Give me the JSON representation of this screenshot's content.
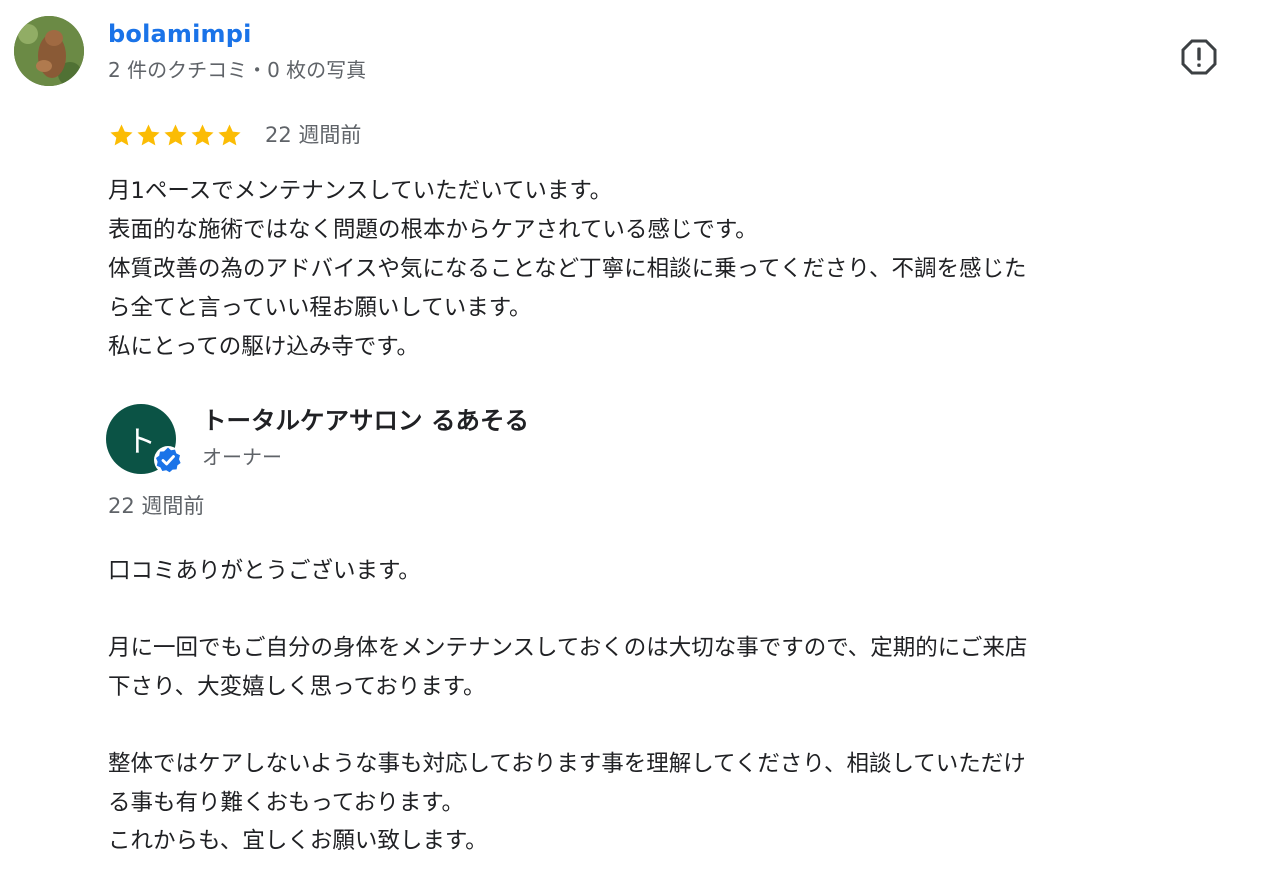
{
  "reviewer": {
    "name": "bolamimpi",
    "meta": "2 件のクチコミ・0 枚の写真",
    "avatar_icon": "user-photo-avatar"
  },
  "actions": {
    "report_icon": "report-flag-icon"
  },
  "review": {
    "rating": 5,
    "rating_max": 5,
    "star_color": "#fbbc04",
    "date": "22 週間前",
    "text": "月1ペースでメンテナンスしていただいています。\n表面的な施術ではなく問題の根本からケアされている感じです。\n体質改善の為のアドバイスや気になることなど丁寧に相談に乗ってくださり、不調を感じた\nら全てと言っていい程お願いしています。\n私にとっての駆け込み寺です。"
  },
  "owner_reply": {
    "avatar_letter": "ト",
    "avatar_color": "#0b5345",
    "verified_color": "#1a73e8",
    "name": "トータルケアサロン るあそる",
    "role": "オーナー",
    "date": "22 週間前",
    "text": "口コミありがとうございます。\n\n月に一回でもご自分の身体をメンテナンスしておくのは大切な事ですので、定期的にご来店\n下さり、大変嬉しく思っております。\n\n整体ではケアしないような事も対応しております事を理解してくださり、相談していただけ\nる事も有り難くおもっております。\nこれからも、宜しくお願い致します。"
  }
}
